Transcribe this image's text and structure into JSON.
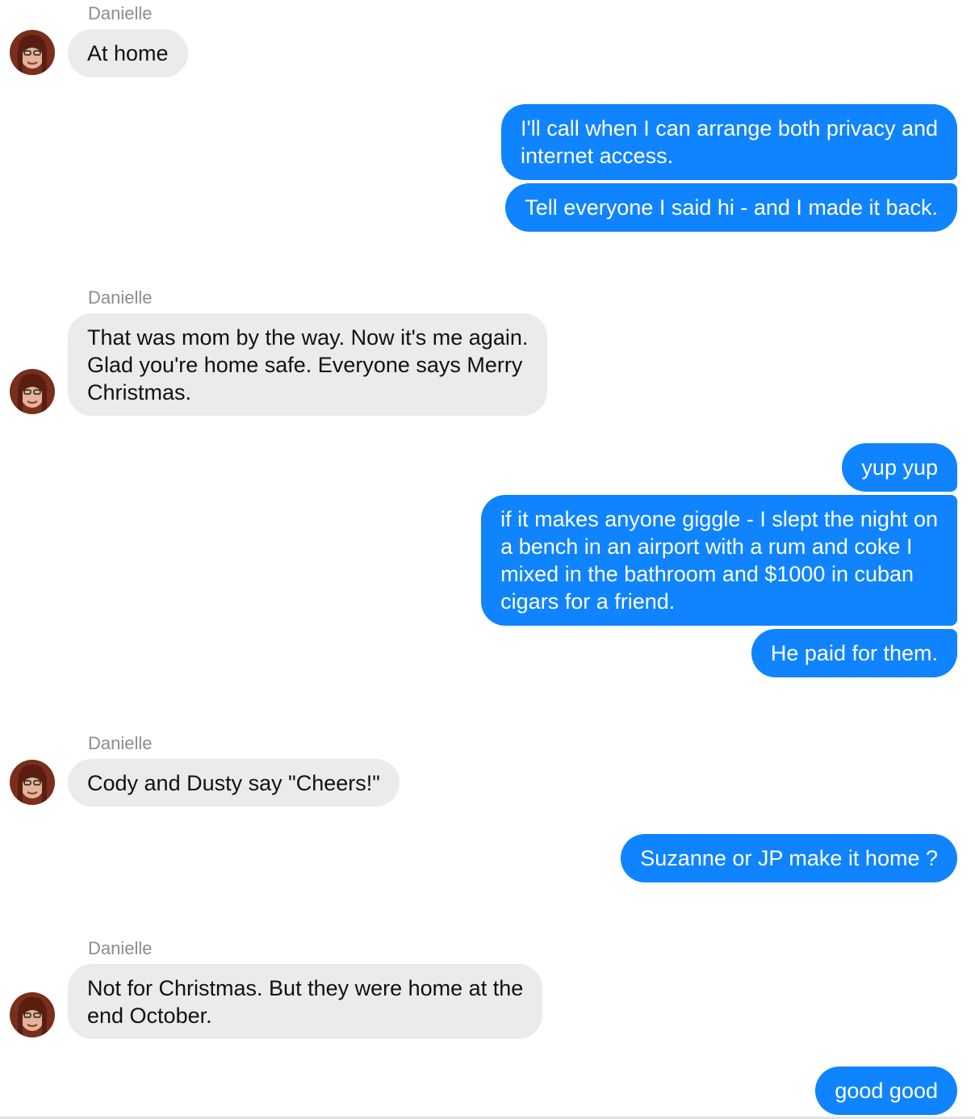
{
  "colors": {
    "incoming_bubble": "#ebebeb",
    "outgoing_bubble": "#0f84fe",
    "sender_label": "#8d8d8d"
  },
  "messages": [
    {
      "sender": "Danielle",
      "text_lines": [
        "At home"
      ]
    },
    {
      "text_lines": [
        "I'll call when I can arrange both privacy and",
        "internet access."
      ]
    },
    {
      "text_lines": [
        "Tell everyone I said hi - and I made it back."
      ]
    },
    {
      "sender": "Danielle",
      "text_lines": [
        "That was mom by the way. Now it's me again.",
        "Glad you're home safe. Everyone says Merry",
        "Christmas."
      ]
    },
    {
      "text_lines": [
        "yup yup"
      ]
    },
    {
      "text_lines": [
        "if it makes anyone giggle - I slept the night on",
        "a bench in an airport with a rum and coke I",
        "mixed in the bathroom and $1000 in cuban",
        "cigars for a friend."
      ]
    },
    {
      "text_lines": [
        "He paid for them."
      ]
    },
    {
      "sender": "Danielle",
      "text_lines": [
        "Cody and Dusty say \"Cheers!\""
      ]
    },
    {
      "text_lines": [
        "Suzanne or JP make it home ?"
      ]
    },
    {
      "sender": "Danielle",
      "text_lines": [
        "Not for Christmas. But they were home at the",
        "end October."
      ]
    },
    {
      "text_lines": [
        "good good"
      ]
    }
  ]
}
